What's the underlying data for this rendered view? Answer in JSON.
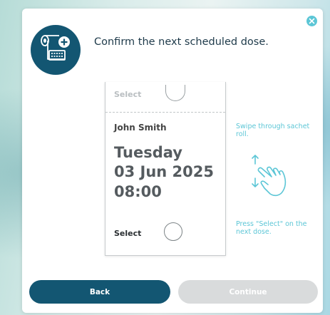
{
  "dialog": {
    "title": "Confirm the next scheduled dose.",
    "close_icon": "close-icon",
    "header_icon": "medication-dispenser-icon"
  },
  "sachet_above": {
    "select_label": "Select"
  },
  "sachet": {
    "patient_name": "John Smith",
    "day": "Tuesday",
    "date": "03 Jun 2025",
    "time": "08:00",
    "select_label": "Select"
  },
  "hints": {
    "swipe": "Swipe through sachet roll.",
    "press": "Press \"Select\" on the next dose.",
    "gesture_icon": "swipe-hand-icon"
  },
  "buttons": {
    "back_label": "Back",
    "continue_label": "Continue"
  },
  "colors": {
    "primary": "#135672",
    "accent": "#5cc6d6",
    "disabled": "#d9dbdc"
  }
}
